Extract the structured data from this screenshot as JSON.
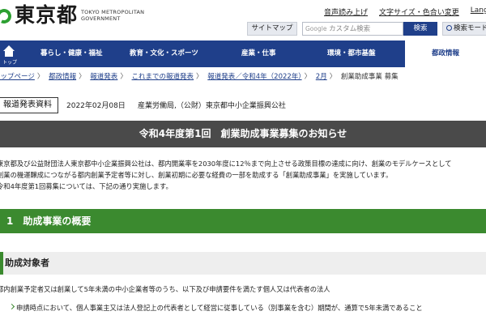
{
  "header": {
    "logo_text": "東京都",
    "logo_sub_1": "TOKYO METROPOLITAN",
    "logo_sub_2": "GOVERNMENT",
    "util_links": [
      "音声読み上げ",
      "文字サイズ・色合い変更",
      "Language"
    ],
    "sitemap_label": "サイトマップ",
    "search_google": "Google",
    "search_placeholder": "カスタム検索",
    "search_button": "検索",
    "advanced_search": "検索モード"
  },
  "nav": {
    "home_label": "トップ",
    "items": [
      "暮らし・健康・福祉",
      "教育・文化・スポーツ",
      "産業・仕事",
      "環境・都市基盤",
      "都政情報"
    ]
  },
  "breadcrumb": {
    "items": [
      "トップページ",
      "都政情報",
      "報道発表",
      "これまでの報道発表",
      "報道発表／令和4年（2022年）",
      "2月"
    ],
    "current": "創業助成事業 募集"
  },
  "meta": {
    "badge": "報道発表資料",
    "date": "2022年02月08日",
    "department": "産業労働局,（公財）東京都中小企業振興公社"
  },
  "title": "令和4年度第1回　創業助成事業募集のお知らせ",
  "body": {
    "para1_line1": "東京都及び公益財団法人東京都中小企業振興公社は、都内開業率を2030年度に12％まで向上させる政策目標の達成に向け、創業のモデルケースとして",
    "para1_line2": "創業の機運醸成につながる都内創業予定者等に対し、創業初期に必要な経費の一部を助成する「創業助成事業」を実施しています。",
    "para2": "令和4年度第1回募集については、下記の通り実施します。"
  },
  "section1": "1　助成事業の概要",
  "subheading": "助成対象者",
  "target_text": "都内創業予定者又は創業して5年未満の中小企業者等のうち、以下及び申請要件を満たす個人又は代表者の法人",
  "bullet1": "申請時点において、個人事業主又は法人登記上の代表者として経営に従事している（別事業を含む）期間が、通算で5年未満であること",
  "colors": {
    "nav_bg": "#1f3f8a",
    "title_bar_bg": "#4a4a4a",
    "section_green": "#3b8a2f",
    "link": "#1f3f8a"
  }
}
